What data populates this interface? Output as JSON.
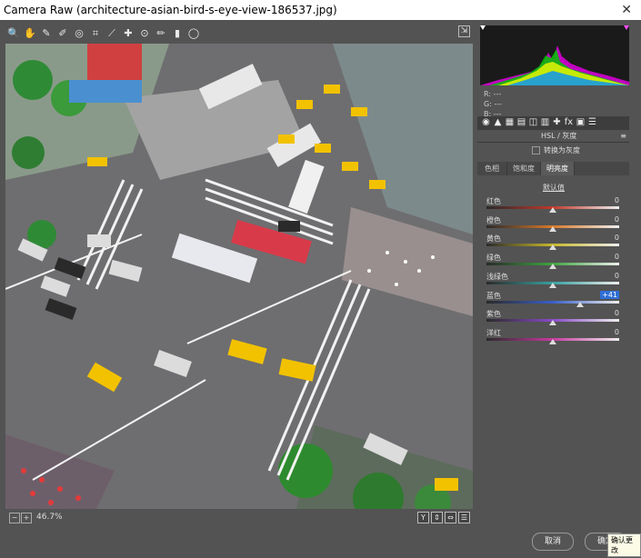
{
  "window": {
    "title": "Camera Raw (architecture-asian-bird-s-eye-view-186537.jpg)",
    "close_symbol": "✕"
  },
  "toolbar": {
    "tools": [
      {
        "name": "zoom-tool-icon",
        "glyph": "🔍"
      },
      {
        "name": "hand-tool-icon",
        "glyph": "✋"
      },
      {
        "name": "white-balance-tool-icon",
        "glyph": "✎"
      },
      {
        "name": "color-sampler-tool-icon",
        "glyph": "✐"
      },
      {
        "name": "targeted-adjustment-tool-icon",
        "glyph": "◎"
      },
      {
        "name": "crop-tool-icon",
        "glyph": "⌗"
      },
      {
        "name": "straighten-tool-icon",
        "glyph": "⟋"
      },
      {
        "name": "spot-removal-tool-icon",
        "glyph": "✚"
      },
      {
        "name": "red-eye-tool-icon",
        "glyph": "⊙"
      },
      {
        "name": "adjustment-brush-icon",
        "glyph": "✏"
      },
      {
        "name": "graduated-filter-icon",
        "glyph": "▮"
      },
      {
        "name": "radial-filter-icon",
        "glyph": "◯"
      }
    ],
    "fullscreen_glyph": "⇲"
  },
  "status": {
    "zoom_out": "−",
    "zoom_in": "+",
    "zoom_level": "46.7%",
    "view_buttons": [
      "Y",
      "⇕",
      "⇔",
      "☰"
    ]
  },
  "histogram": {
    "rgb": [
      "R:  ---",
      "G:  ---",
      "B:  ---"
    ]
  },
  "panel_tabs_icons": [
    "◉",
    "▲",
    "▦",
    "▤",
    "◫",
    "▥",
    "✚",
    "fx",
    "▣",
    "☰"
  ],
  "panel": {
    "title": "HSL / 灰度",
    "menu": "≡",
    "grayscale_label": "转换为灰度",
    "tabs": [
      "色相",
      "饱和度",
      "明亮度"
    ],
    "active_tab": 2,
    "default_link": "默认值",
    "sliders": [
      {
        "label": "红色",
        "value": "0",
        "pos": 0.5,
        "color": "#c0392b"
      },
      {
        "label": "橙色",
        "value": "0",
        "pos": 0.5,
        "color": "#d87a2a"
      },
      {
        "label": "黄色",
        "value": "0",
        "pos": 0.5,
        "color": "#c8b82c"
      },
      {
        "label": "绿色",
        "value": "0",
        "pos": 0.5,
        "color": "#3fa43f"
      },
      {
        "label": "浅绿色",
        "value": "0",
        "pos": 0.5,
        "color": "#3aa0a0"
      },
      {
        "label": "蓝色",
        "value": "+41",
        "pos": 0.705,
        "color": "#3a5fc8",
        "selected": true
      },
      {
        "label": "紫色",
        "value": "0",
        "pos": 0.5,
        "color": "#8a4ac8"
      },
      {
        "label": "洋红",
        "value": "0",
        "pos": 0.5,
        "color": "#c83aa0"
      }
    ]
  },
  "buttons": {
    "cancel": "取消",
    "ok": "确定"
  },
  "tooltip": "确认更改"
}
